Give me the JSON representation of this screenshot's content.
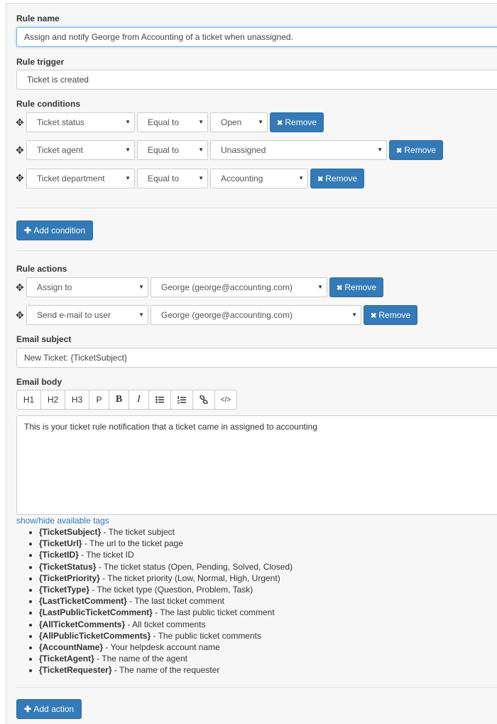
{
  "rule_name": {
    "label": "Rule name",
    "value": "Assign and notify George from Accounting of a ticket when unassigned."
  },
  "rule_trigger": {
    "label": "Rule trigger",
    "value": "Ticket is created"
  },
  "rule_conditions": {
    "label": "Rule conditions",
    "rows": [
      {
        "field": "Ticket status",
        "operator": "Equal to",
        "value": "Open",
        "remove": "Remove"
      },
      {
        "field": "Ticket agent",
        "operator": "Equal to",
        "value": "Unassigned",
        "remove": "Remove"
      },
      {
        "field": "Ticket department",
        "operator": "Equal to",
        "value": "Accounting",
        "remove": "Remove"
      }
    ],
    "add_label": "Add condition"
  },
  "rule_actions": {
    "label": "Rule actions",
    "rows": [
      {
        "action": "Assign to",
        "target": "George (george@accounting.com)",
        "remove": "Remove"
      },
      {
        "action": "Send e-mail to user",
        "target": "George (george@accounting.com)",
        "remove": "Remove"
      }
    ],
    "add_label": "Add action"
  },
  "email_subject": {
    "label": "Email subject",
    "value": "New Ticket: {TicketSubject}"
  },
  "email_body": {
    "label": "Email body",
    "toolbar": [
      "H1",
      "H2",
      "H3",
      "P",
      "B",
      "I",
      "bulleted-list-icon",
      "numbered-list-icon",
      "link-icon",
      "code-icon"
    ],
    "text": "This is your ticket rule notification that a ticket came in assigned to accounting"
  },
  "tags_toggle": "show/hide available tags",
  "tags": [
    {
      "tag": "{TicketSubject}",
      "desc": " - The ticket subject"
    },
    {
      "tag": "{TicketUrl}",
      "desc": " - The url to the ticket page"
    },
    {
      "tag": "{TicketID}",
      "desc": " - The ticket ID"
    },
    {
      "tag": "{TicketStatus}",
      "desc": " - The ticket status (Open, Pending, Solved, Closed)"
    },
    {
      "tag": "{TicketPriority}",
      "desc": " - The ticket priority (Low, Normal, High, Urgent)"
    },
    {
      "tag": "{TicketType}",
      "desc": " - The ticket type (Question, Problem, Task)"
    },
    {
      "tag": "{LastTicketComment}",
      "desc": " - The last ticket comment"
    },
    {
      "tag": "{LastPublicTicketComment}",
      "desc": " - The last public ticket comment"
    },
    {
      "tag": "{AllTicketComments}",
      "desc": " - All ticket comments"
    },
    {
      "tag": "{AllPublicTicketComments}",
      "desc": " - The public ticket comments"
    },
    {
      "tag": "{AccountName}",
      "desc": " - Your helpdesk account name"
    },
    {
      "tag": "{TicketAgent}",
      "desc": " - The name of the agent"
    },
    {
      "tag": "{TicketRequester}",
      "desc": " - The name of the requester"
    }
  ],
  "colors": {
    "primary": "#337ab7",
    "panel_bg": "#f7f7f7",
    "link": "#337ab7"
  }
}
